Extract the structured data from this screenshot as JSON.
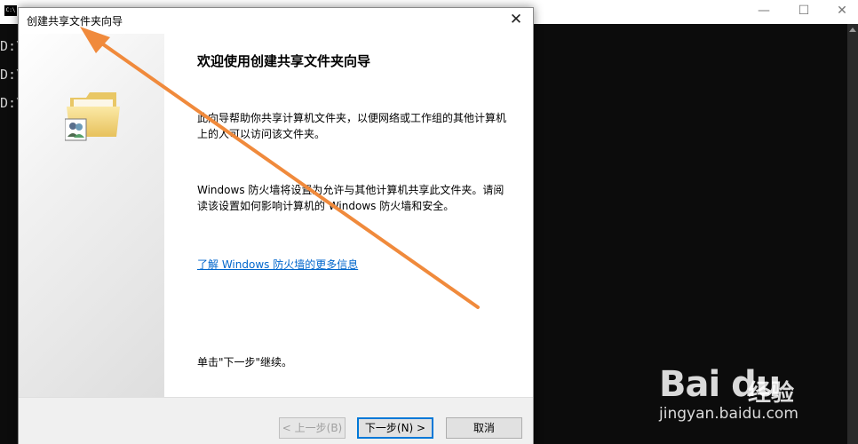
{
  "console": {
    "lines": [
      "D:\\",
      "D:\\",
      "D:\\"
    ],
    "min": "—",
    "max": "☐",
    "close": "✕"
  },
  "dialog": {
    "title": "创建共享文件夹向导",
    "close": "✕",
    "heading": "欢迎使用创建共享文件夹向导",
    "para1": "此向导帮助你共享计算机文件夹，以便网络或工作组的其他计算机上的人可以访问该文件夹。",
    "para2": "Windows 防火墙将设置为允许与其他计算机共享此文件夹。请阅读该设置如何影响计算机的 Windows 防火墙和安全。",
    "link": "了解 Windows 防火墙的更多信息",
    "continue": "单击\"下一步\"继续。",
    "buttons": {
      "back": "< 上一步(B)",
      "next": "下一步(N) >",
      "cancel": "取消"
    }
  },
  "watermark": {
    "logo": "Bai du",
    "sub": "经验",
    "url": "jingyan.baidu.com"
  },
  "colors": {
    "arrow": "#f08a3c",
    "link": "#0066cc",
    "primary_border": "#0078d7"
  }
}
